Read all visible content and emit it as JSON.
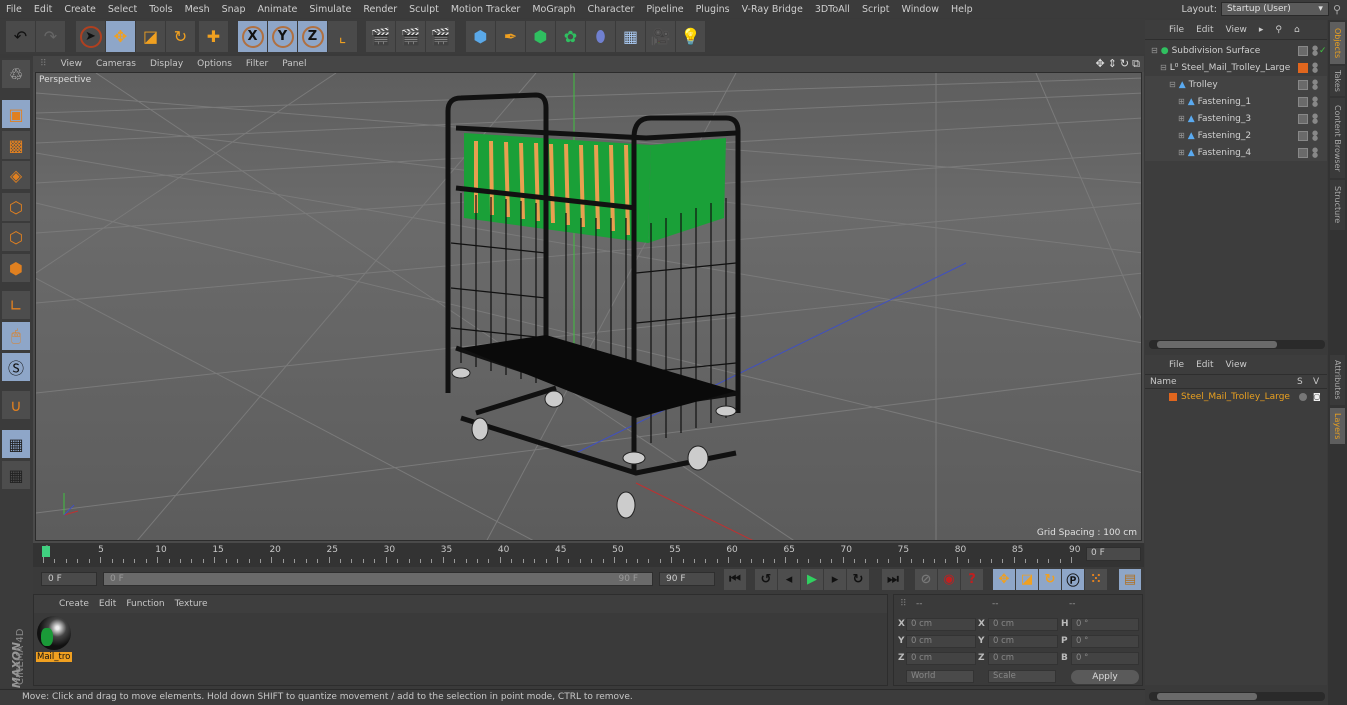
{
  "menubar": {
    "items": [
      "File",
      "Edit",
      "Create",
      "Select",
      "Tools",
      "Mesh",
      "Snap",
      "Animate",
      "Simulate",
      "Render",
      "Sculpt",
      "Motion Tracker",
      "MoGraph",
      "Character",
      "Pipeline",
      "Plugins",
      "V-Ray Bridge",
      "3DToAll",
      "Script",
      "Window",
      "Help"
    ],
    "layout_label": "Layout:",
    "layout_value": "Startup (User)"
  },
  "toolbar": {
    "undo": "undo-icon",
    "redo": "redo-icon",
    "tools": [
      "live-selection",
      "move",
      "scale",
      "rotate",
      "add-object"
    ],
    "axes": [
      "X",
      "Y",
      "Z"
    ],
    "coord_system": "world-coordinate-icon",
    "render": [
      "render-view",
      "render-to-picture-viewer",
      "render-settings"
    ],
    "create": [
      "cube",
      "pen",
      "subdivision-surface",
      "cloner",
      "deformer",
      "floor",
      "camera",
      "light"
    ]
  },
  "viewport": {
    "menu": [
      "View",
      "Cameras",
      "Display",
      "Options",
      "Filter",
      "Panel"
    ],
    "label": "Perspective",
    "grid_spacing": "Grid Spacing : 100 cm"
  },
  "left_tools": [
    "make-editable",
    "texture-mode",
    "workplane",
    "points-mode",
    "edges-mode",
    "polygons-mode",
    "axis-mode",
    "tweak-mode",
    "snap",
    "magnet",
    "lock-workplane",
    "planar-workplane"
  ],
  "timeline": {
    "ticks": [
      "0",
      "5",
      "10",
      "15",
      "20",
      "25",
      "30",
      "35",
      "40",
      "45",
      "50",
      "55",
      "60",
      "65",
      "70",
      "75",
      "80",
      "85",
      "90"
    ],
    "current_frame": "0 F",
    "start_field": "0 F",
    "range_start": "0 F",
    "range_end": "90 F",
    "end_field": "90 F"
  },
  "material_manager": {
    "menu": [
      "Create",
      "Edit",
      "Function",
      "Texture"
    ],
    "materials": [
      {
        "name": "Mail_tro"
      }
    ],
    "brand_top": "MAXON",
    "brand_bottom": "CINEMA 4D"
  },
  "coordinates": {
    "headers": [
      "--",
      "--",
      "--"
    ],
    "rows": [
      {
        "l1": "X",
        "v1": "0 cm",
        "l2": "X",
        "v2": "0 cm",
        "l3": "H",
        "v3": "0 °"
      },
      {
        "l1": "Y",
        "v1": "0 cm",
        "l2": "Y",
        "v2": "0 cm",
        "l3": "P",
        "v3": "0 °"
      },
      {
        "l1": "Z",
        "v1": "0 cm",
        "l2": "Z",
        "v2": "0 cm",
        "l3": "B",
        "v3": "0 °"
      }
    ],
    "mode": "World",
    "transform": "Scale",
    "apply": "Apply"
  },
  "status": "Move: Click and drag to move elements. Hold down SHIFT to quantize movement / add to the selection in point mode, CTRL to remove.",
  "object_manager": {
    "menu": [
      "File",
      "Edit",
      "View"
    ],
    "objects": [
      {
        "name": "Subdivision Surface",
        "indent": 0,
        "icon": "subdivision-icon"
      },
      {
        "name": "Steel_Mail_Trolley_Large",
        "indent": 1,
        "icon": "null-icon"
      },
      {
        "name": "Trolley",
        "indent": 2,
        "icon": "polygon-icon"
      },
      {
        "name": "Fastening_1",
        "indent": 3,
        "icon": "polygon-icon"
      },
      {
        "name": "Fastening_3",
        "indent": 3,
        "icon": "polygon-icon"
      },
      {
        "name": "Fastening_2",
        "indent": 3,
        "icon": "polygon-icon"
      },
      {
        "name": "Fastening_4",
        "indent": 3,
        "icon": "polygon-icon"
      }
    ]
  },
  "layer_manager": {
    "menu": [
      "File",
      "Edit",
      "View"
    ],
    "columns": [
      "Name",
      "S",
      "V"
    ],
    "layers": [
      {
        "name": "Steel_Mail_Trolley_Large",
        "color": "#e0661e"
      }
    ]
  },
  "side_tabs": {
    "top": [
      "Objects",
      "Takes",
      "Content Browser",
      "Structure"
    ],
    "bottom": [
      "Attributes",
      "Layers"
    ]
  },
  "colors": {
    "accent": "#e9a020",
    "selected_blue": "#8ea6c8",
    "layer_orange": "#e0661e"
  }
}
